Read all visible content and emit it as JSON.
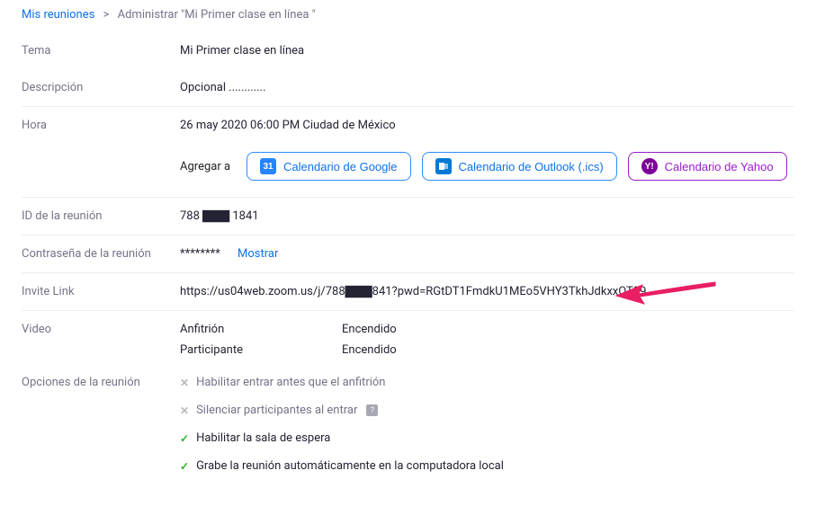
{
  "breadcrumb": {
    "root": "Mis reuniones",
    "current": "Administrar \"Mi Primer clase en línea \""
  },
  "labels": {
    "tema": "Tema",
    "descripcion": "Descripción",
    "hora": "Hora",
    "agregar_a": "Agregar a",
    "id": "ID de la reunión",
    "contrasena": "Contraseña de la reunión",
    "invite": "Invite Link",
    "video": "Video",
    "opciones": "Opciones de la reunión"
  },
  "values": {
    "tema": "Mi Primer clase en línea",
    "descripcion": "Opcional ............",
    "hora": "26 may 2020 06:00 PM Ciudad de México",
    "id": "788 ▇▇▇ 1841",
    "contrasena_masked": "********",
    "mostrar": "Mostrar",
    "invite_link": "https://us04web.zoom.us/j/788▇▇▇841?pwd=RGtDT1FmdkU1MEo5VHY3TkhJdkxxQT09"
  },
  "calendar": {
    "google": "Calendario de Google",
    "google_badge": "31",
    "outlook": "Calendario de Outlook (.ics)",
    "yahoo": "Calendario de Yahoo",
    "yahoo_badge": "Y!"
  },
  "video": {
    "host_label": "Anfitrión",
    "host_value": "Encendido",
    "participant_label": "Participante",
    "participant_value": "Encendido"
  },
  "options": {
    "join_before": "Habilitar entrar antes que el anfitrión",
    "mute_on_entry": "Silenciar participantes al entrar",
    "waiting_room": "Habilitar la sala de espera",
    "auto_record": "Grabe la reunión automáticamente en la computadora local"
  },
  "colors": {
    "link": "#0e71eb",
    "yahoo": "#971eca",
    "arrow": "#e91e63"
  }
}
